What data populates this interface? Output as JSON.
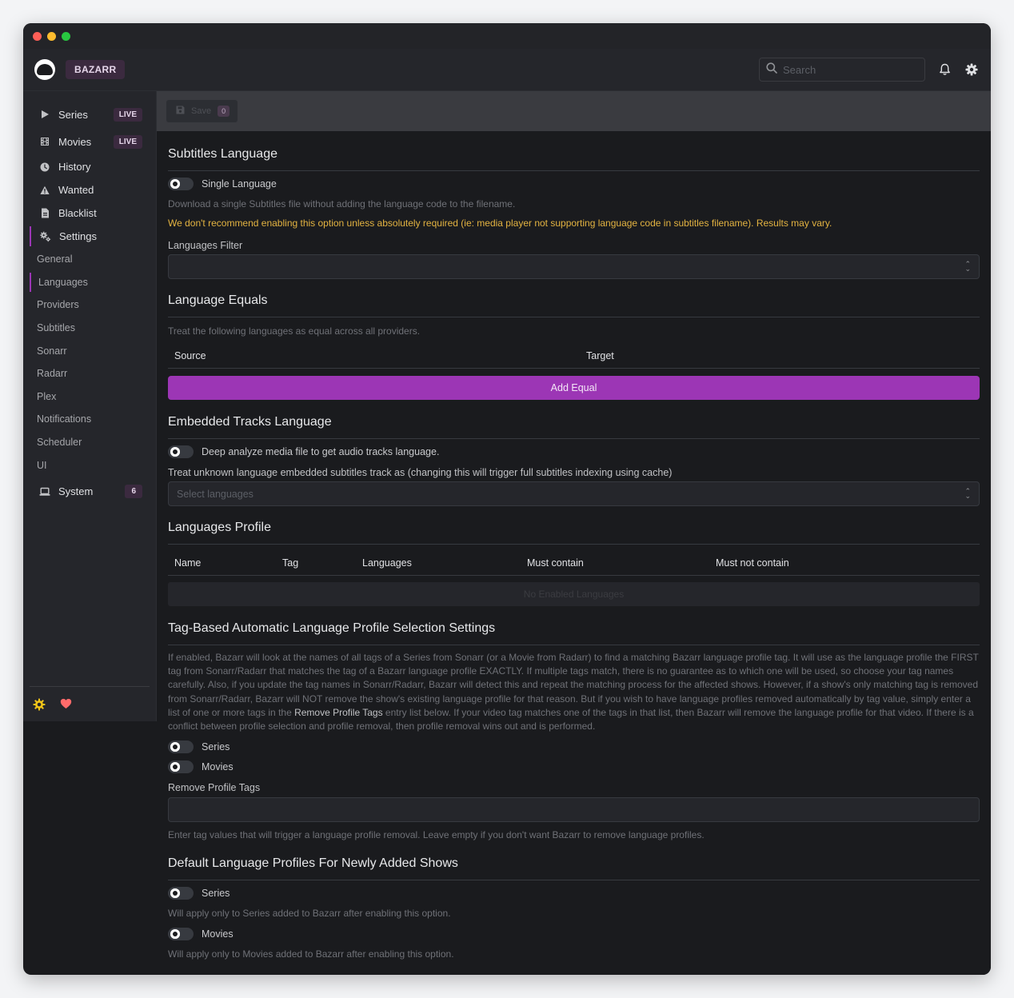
{
  "app": {
    "brand": "BAZARR"
  },
  "header": {
    "search_placeholder": "Search"
  },
  "colors": {
    "accent": "#9c36b5",
    "warning": "#e3b341",
    "window_bg": "#1a1b1e",
    "sidebar_bg": "#25262b"
  },
  "sidebar": {
    "items": [
      {
        "label": "Series",
        "icon": "play-icon",
        "badge": "LIVE"
      },
      {
        "label": "Movies",
        "icon": "film-icon",
        "badge": "LIVE"
      },
      {
        "label": "History",
        "icon": "clock-icon"
      },
      {
        "label": "Wanted",
        "icon": "warning-icon"
      },
      {
        "label": "Blacklist",
        "icon": "file-icon"
      },
      {
        "label": "Settings",
        "icon": "gears-icon"
      }
    ],
    "settings_sub": [
      "General",
      "Languages",
      "Providers",
      "Subtitles",
      "Sonarr",
      "Radarr",
      "Plex",
      "Notifications",
      "Scheduler",
      "UI"
    ],
    "system": {
      "label": "System",
      "badge": "6"
    }
  },
  "toolbar": {
    "save_label": "Save",
    "save_count": "0"
  },
  "subtitles_language": {
    "title": "Subtitles Language",
    "single_language_label": "Single Language",
    "single_language_desc": "Download a single Subtitles file without adding the language code to the filename.",
    "warning": "We don't recommend enabling this option unless absolutely required (ie: media player not supporting language code in subtitles filename). Results may vary.",
    "filter_label": "Languages Filter"
  },
  "language_equals": {
    "title": "Language Equals",
    "desc": "Treat the following languages as equal across all providers.",
    "col_source": "Source",
    "col_target": "Target",
    "add_button": "Add Equal"
  },
  "embedded": {
    "title": "Embedded Tracks Language",
    "deep_analyze_label": "Deep analyze media file to get audio tracks language.",
    "unknown_label": "Treat unknown language embedded subtitles track as (changing this will trigger full subtitles indexing using cache)",
    "select_placeholder": "Select languages"
  },
  "profiles": {
    "title": "Languages Profile",
    "columns": [
      "Name",
      "Tag",
      "Languages",
      "Must contain",
      "Must not contain"
    ],
    "empty": "No Enabled Languages"
  },
  "tag_based": {
    "title": "Tag-Based Automatic Language Profile Selection Settings",
    "desc_part1": "If enabled, Bazarr will look at the names of all tags of a Series from Sonarr (or a Movie from Radarr) to find a matching Bazarr language profile tag. It will use as the language profile the FIRST tag from Sonarr/Radarr that matches the tag of a Bazarr language profile EXACTLY. If multiple tags match, there is no guarantee as to which one will be used, so choose your tag names carefully. Also, if you update the tag names in Sonarr/Radarr, Bazarr will detect this and repeat the matching process for the affected shows. However, if a show's only matching tag is removed from Sonarr/Radarr, Bazarr will NOT remove the show's existing language profile for that reason. But if you wish to have language profiles removed automatically by tag value, simply enter a list of one or more tags in the ",
    "desc_bold": "Remove Profile Tags",
    "desc_part2": " entry list below. If your video tag matches one of the tags in that list, then Bazarr will remove the language profile for that video. If there is a conflict between profile selection and profile removal, then profile removal wins out and is performed.",
    "series_label": "Series",
    "movies_label": "Movies",
    "remove_tags_label": "Remove Profile Tags",
    "remove_tags_desc": "Enter tag values that will trigger a language profile removal. Leave empty if you don't want Bazarr to remove language profiles."
  },
  "defaults": {
    "title": "Default Language Profiles For Newly Added Shows",
    "series_label": "Series",
    "series_desc": "Will apply only to Series added to Bazarr after enabling this option.",
    "movies_label": "Movies",
    "movies_desc": "Will apply only to Movies added to Bazarr after enabling this option."
  }
}
